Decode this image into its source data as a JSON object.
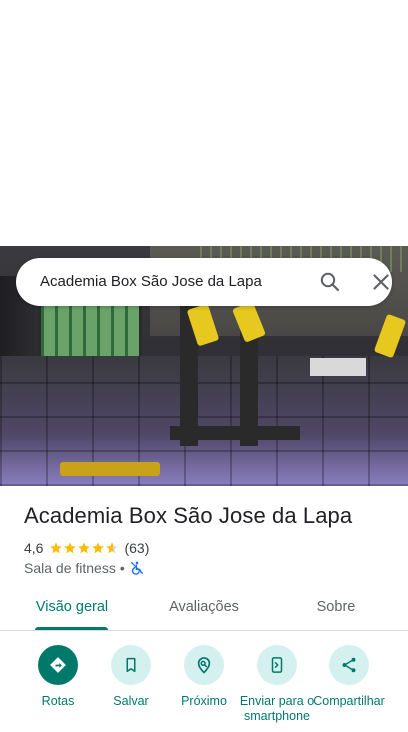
{
  "search": {
    "query": "Academia Box São Jose da Lapa"
  },
  "place": {
    "name": "Academia Box São Jose da Lapa",
    "rating": "4,6",
    "rating_value": 4.6,
    "review_count": "(63)",
    "category": "Sala de fitness",
    "separator": "•"
  },
  "tabs": [
    {
      "label": "Visão geral",
      "active": true
    },
    {
      "label": "Avaliações",
      "active": false
    },
    {
      "label": "Sobre",
      "active": false
    }
  ],
  "actions": [
    {
      "label": "Rotas",
      "icon": "directions-icon"
    },
    {
      "label": "Salvar",
      "icon": "bookmark-icon"
    },
    {
      "label": "Próximo",
      "icon": "nearby-icon"
    },
    {
      "label": "Enviar para o smartphone",
      "icon": "send-to-phone-icon"
    },
    {
      "label": "Compartilhar",
      "icon": "share-icon"
    }
  ],
  "colors": {
    "accent": "#00796b",
    "action_bg": "#d4f0ef",
    "star": "#fbbc04",
    "wheelchair": "#1a73e8"
  }
}
